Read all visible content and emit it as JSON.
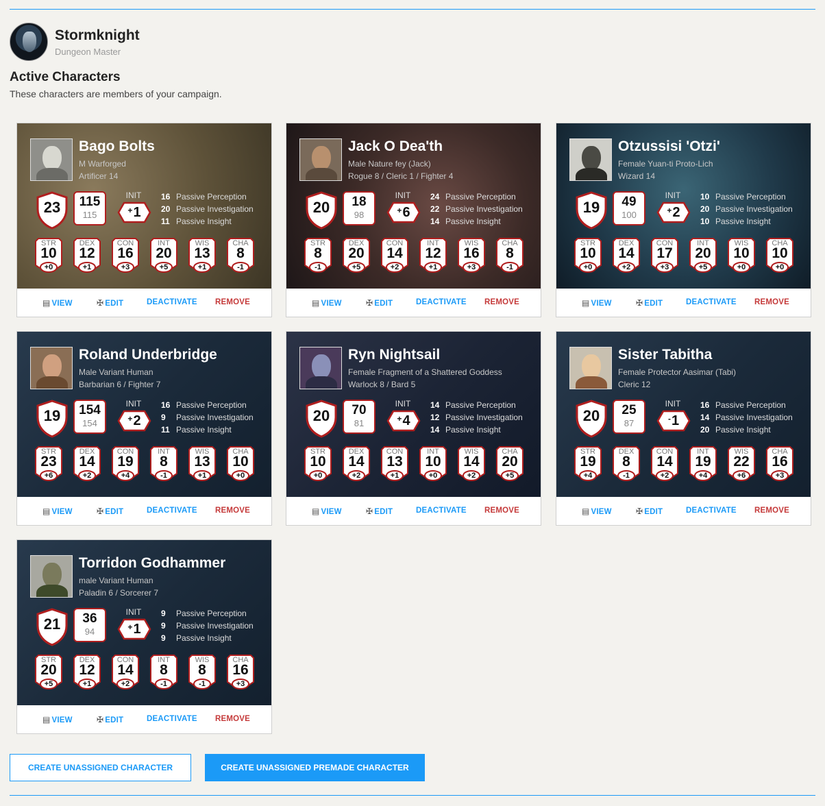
{
  "dm": {
    "name": "Stormknight",
    "role": "Dungeon Master"
  },
  "section": {
    "title": "Active Characters",
    "subtitle": "These characters are members of your campaign."
  },
  "labels": {
    "init": "INIT",
    "view": "VIEW",
    "edit": "EDIT",
    "deactivate": "DEACTIVATE",
    "remove": "REMOVE",
    "passive_perception": "Passive Perception",
    "passive_investigation": "Passive Investigation",
    "passive_insight": "Passive Insight",
    "abilities": [
      "STR",
      "DEX",
      "CON",
      "INT",
      "WIS",
      "CHA"
    ]
  },
  "characters": [
    {
      "name": "Bago Bolts",
      "line1": "M Warforged",
      "line2": "Artificer 14",
      "ac": "23",
      "hp_cur": "115",
      "hp_max": "115",
      "init_sign": "+",
      "init_val": "1",
      "perception": "16",
      "investigation": "20",
      "insight": "11",
      "scores": [
        "10",
        "12",
        "16",
        "20",
        "13",
        "8"
      ],
      "mods": [
        "+0",
        "+1",
        "+3",
        "+5",
        "+1",
        "-1"
      ]
    },
    {
      "name": "Jack O Dea'th",
      "line1": "Male Nature fey (Jack)",
      "line2": "Rogue 8 / Cleric 1 / Fighter 4",
      "ac": "20",
      "hp_cur": "18",
      "hp_max": "98",
      "init_sign": "+",
      "init_val": "6",
      "perception": "24",
      "investigation": "22",
      "insight": "14",
      "scores": [
        "8",
        "20",
        "14",
        "12",
        "16",
        "8"
      ],
      "mods": [
        "-1",
        "+5",
        "+2",
        "+1",
        "+3",
        "-1"
      ]
    },
    {
      "name": "Otzussisi 'Otzi'",
      "line1": "Female Yuan-ti Proto-Lich",
      "line2": "Wizard 14",
      "ac": "19",
      "hp_cur": "49",
      "hp_max": "100",
      "init_sign": "+",
      "init_val": "2",
      "perception": "10",
      "investigation": "20",
      "insight": "10",
      "scores": [
        "10",
        "14",
        "17",
        "20",
        "10",
        "10"
      ],
      "mods": [
        "+0",
        "+2",
        "+3",
        "+5",
        "+0",
        "+0"
      ]
    },
    {
      "name": "Roland Underbridge",
      "line1": "Male Variant Human",
      "line2": "Barbarian 6 / Fighter 7",
      "ac": "19",
      "hp_cur": "154",
      "hp_max": "154",
      "init_sign": "+",
      "init_val": "2",
      "perception": "16",
      "investigation": "9",
      "insight": "11",
      "scores": [
        "23",
        "14",
        "19",
        "8",
        "13",
        "10"
      ],
      "mods": [
        "+6",
        "+2",
        "+4",
        "-1",
        "+1",
        "+0"
      ]
    },
    {
      "name": "Ryn Nightsail",
      "line1": "Female Fragment of a Shattered Goddess",
      "line2": "Warlock 8 / Bard 5",
      "ac": "20",
      "hp_cur": "70",
      "hp_max": "81",
      "init_sign": "+",
      "init_val": "4",
      "perception": "14",
      "investigation": "12",
      "insight": "14",
      "scores": [
        "10",
        "14",
        "13",
        "10",
        "14",
        "20"
      ],
      "mods": [
        "+0",
        "+2",
        "+1",
        "+0",
        "+2",
        "+5"
      ]
    },
    {
      "name": "Sister Tabitha",
      "line1": "Female Protector Aasimar (Tabi)",
      "line2": "Cleric 12",
      "ac": "20",
      "hp_cur": "25",
      "hp_max": "87",
      "init_sign": "-",
      "init_val": "1",
      "perception": "16",
      "investigation": "14",
      "insight": "20",
      "scores": [
        "19",
        "8",
        "14",
        "19",
        "22",
        "16"
      ],
      "mods": [
        "+4",
        "-1",
        "+2",
        "+4",
        "+6",
        "+3"
      ]
    },
    {
      "name": "Torridon Godhammer",
      "line1": "male Variant Human",
      "line2": "Paladin 6 / Sorcerer 7",
      "ac": "21",
      "hp_cur": "36",
      "hp_max": "94",
      "init_sign": "+",
      "init_val": "1",
      "perception": "9",
      "investigation": "9",
      "insight": "9",
      "scores": [
        "20",
        "12",
        "14",
        "8",
        "8",
        "16"
      ],
      "mods": [
        "+5",
        "+1",
        "+2",
        "-1",
        "-1",
        "+3"
      ]
    }
  ],
  "buttons": {
    "create_unassigned": "CREATE UNASSIGNED CHARACTER",
    "create_premade": "CREATE UNASSIGNED PREMADE CHARACTER"
  },
  "colors": {
    "accent": "#1b9af7",
    "remove": "#c53a3a",
    "shield_border": "#b01e1e"
  }
}
